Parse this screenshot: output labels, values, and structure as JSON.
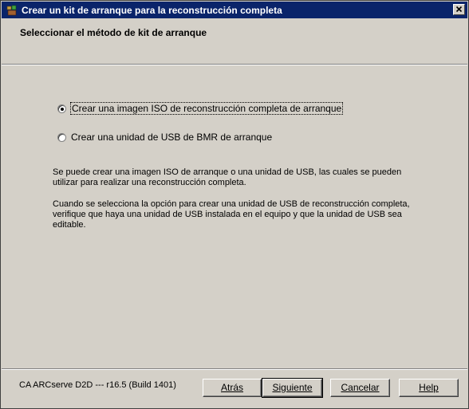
{
  "window": {
    "title": "Crear un kit de arranque para la reconstrucción completa",
    "icon": "app-icon",
    "close_icon": "close-icon"
  },
  "header": {
    "title": "Seleccionar el método de kit de arranque"
  },
  "options": [
    {
      "label": "Crear una imagen ISO de reconstrucción completa de arranque",
      "selected": true
    },
    {
      "label": "Crear una unidad de USB de BMR de arranque",
      "selected": false
    }
  ],
  "description": {
    "paragraph1_line1": "Se puede crear una imagen ISO de arranque o una unidad de USB, las cuales se pueden",
    "paragraph1_line2": "utilizar para realizar una reconstrucción completa.",
    "paragraph2_line1": "Cuando se selecciona la opción para crear una unidad de USB de reconstrucción completa,",
    "paragraph2_line2": "verifique que haya una unidad de USB instalada en el equipo y que la unidad de USB sea",
    "paragraph2_line3": "editable."
  },
  "footer": {
    "version": "CA ARCserve D2D --- r16.5 (Build 1401)",
    "back_label": "Atrás",
    "next_label": "Siguiente",
    "cancel_label": "Cancelar",
    "help_label": "Help"
  }
}
